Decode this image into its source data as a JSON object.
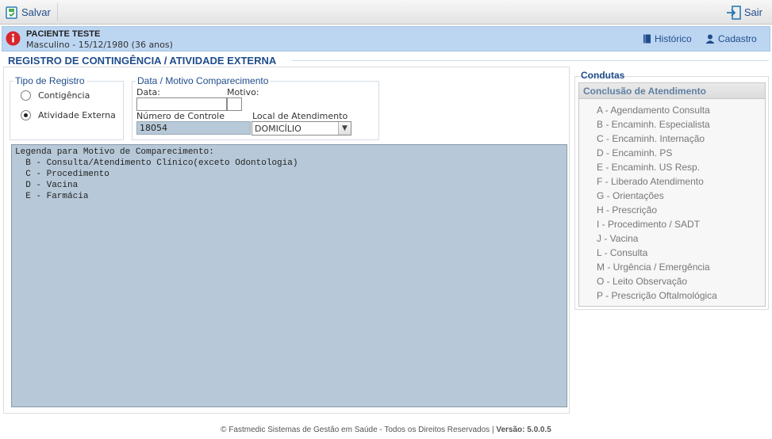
{
  "toolbar": {
    "save_label": "Salvar",
    "exit_label": "Sair"
  },
  "patient": {
    "name": "PACIENTE TESTE",
    "description": "Masculino - 15/12/1980 (36 anos)",
    "history_link": "Histórico",
    "register_link": "Cadastro"
  },
  "page_title": "REGISTRO DE CONTINGÊNCIA / ATIVIDADE EXTERNA",
  "tipo_registro": {
    "legend": "Tipo de Registro",
    "options": [
      {
        "label": "Contigência",
        "selected": false
      },
      {
        "label": "Atividade Externa",
        "selected": true
      }
    ]
  },
  "data_motivo": {
    "legend": "Data / Motivo Comparecimento",
    "data_label": "Data:",
    "data_value": "",
    "motivo_label": "Motivo:",
    "motivo_value": "",
    "numero_label": "Número de Controle",
    "numero_value": "18054",
    "local_label": "Local de Atendimento",
    "local_value": "DOMICÍLIO"
  },
  "legenda": {
    "lines": [
      "Legenda para Motivo de Comparecimento:",
      "  B - Consulta/Atendimento Clínico(exceto Odontologia)",
      "  C - Procedimento",
      "  D - Vacina",
      "  E - Farmácia"
    ]
  },
  "condutas": {
    "title": "Condutas",
    "header": "Conclusão de Atendimento",
    "items": [
      "A - Agendamento Consulta",
      "B - Encaminh. Especialista",
      "C - Encaminh. Internação",
      "D - Encaminh. PS",
      "E - Encaminh. US Resp.",
      "F - Liberado Atendimento",
      "G - Orientações",
      "H - Prescrição",
      "I - Procedimento / SADT",
      "J - Vacina",
      "L - Consulta",
      "M - Urgência / Emergência",
      "O - Leito Observação",
      "P - Prescrição Oftalmológica"
    ]
  },
  "footer": {
    "text": "© Fastmedic Sistemas de Gestão em Saúde - Todos os Direitos Reservados | ",
    "version": "Versão: 5.0.0.5"
  },
  "icons": {
    "save": "save-icon",
    "exit": "exit-icon",
    "info": "info-icon",
    "history": "book-icon",
    "register": "user-icon"
  },
  "colors": {
    "accent": "#1f4d8c",
    "patient_bar": "#bcd6f2",
    "readonly_field": "#b7c9d8",
    "alert": "#d8262c"
  }
}
